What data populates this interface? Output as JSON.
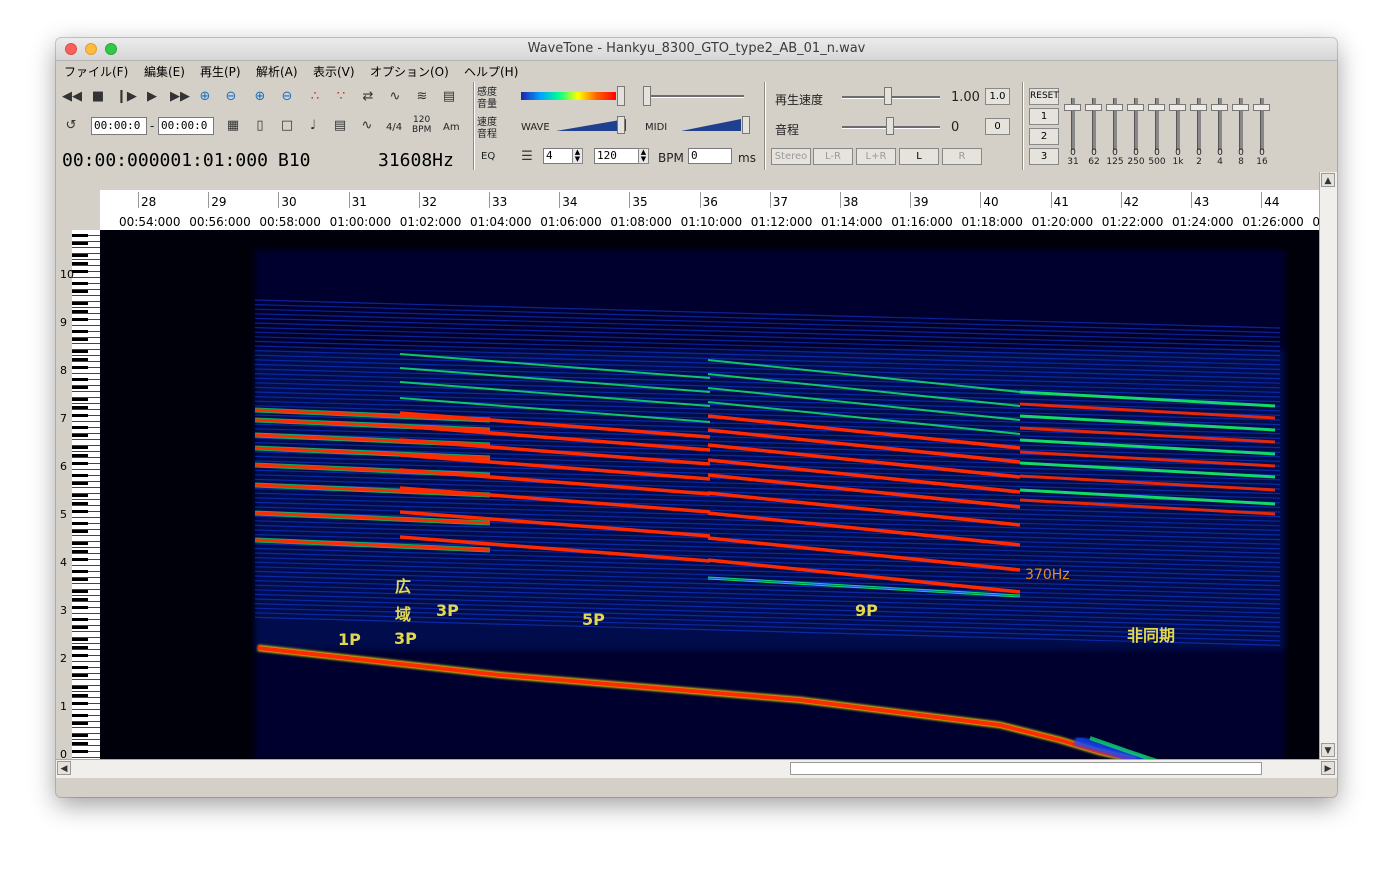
{
  "window": {
    "title": "WaveTone - Hankyu_8300_GTO_type2_AB_01_n.wav"
  },
  "menu": [
    {
      "label": "ファイル(F)",
      "name": "menu-file"
    },
    {
      "label": "編集(E)",
      "name": "menu-edit"
    },
    {
      "label": "再生(P)",
      "name": "menu-play"
    },
    {
      "label": "解析(A)",
      "name": "menu-analyze"
    },
    {
      "label": "表示(V)",
      "name": "menu-view"
    },
    {
      "label": "オプション(O)",
      "name": "menu-options"
    },
    {
      "label": "ヘルプ(H)",
      "name": "menu-help"
    }
  ],
  "transport": {
    "icons": [
      "rewind-icon",
      "stop-icon",
      "step-icon",
      "play-icon",
      "fast-forward-icon",
      "zoom-in-icon",
      "zoom-out-icon",
      "zoom-in-vertical-icon",
      "zoom-out-vertical-icon",
      "marker-icon",
      "marker-range-icon",
      "loop-arrows-icon",
      "waveform-icon",
      "waveform-alt-icon",
      "book-icon"
    ]
  },
  "toolbar2": {
    "start_time": "00:00:0",
    "dash": "-",
    "end_time": "00:00:0",
    "time_sig": "4/4",
    "bpm_top": "120",
    "bpm_bottom": "BPM",
    "chord_label": "Am"
  },
  "status": {
    "position": "00:00:000001:01:000",
    "note": "B10",
    "frequency": "31608Hz"
  },
  "labels": {
    "sensitivity": "感度",
    "volume": "音量",
    "speed": "速度",
    "pitch_short": "音程",
    "eq": "EQ",
    "wave": "WAVE",
    "midi": "MIDI",
    "bpm": "BPM",
    "ms": "ms",
    "beats_value": "4",
    "tempo_value": "120",
    "ms_value": "0"
  },
  "playback": {
    "speed_label": "再生速度",
    "speed_value": "1.00",
    "speed_reset": "1.0",
    "pitch_label": "音程",
    "pitch_value": "0",
    "pitch_reset": "0",
    "channels": [
      {
        "label": "Stereo",
        "enabled": false
      },
      {
        "label": "L-R",
        "enabled": false
      },
      {
        "label": "L+R",
        "enabled": false
      },
      {
        "label": "L",
        "enabled": true
      },
      {
        "label": "R",
        "enabled": false
      }
    ]
  },
  "eq": {
    "reset_label": "RESET",
    "presets": [
      "1",
      "2",
      "3"
    ],
    "bands": [
      {
        "freq": "31",
        "level": "0"
      },
      {
        "freq": "62",
        "level": "0"
      },
      {
        "freq": "125",
        "level": "0"
      },
      {
        "freq": "250",
        "level": "0"
      },
      {
        "freq": "500",
        "level": "0"
      },
      {
        "freq": "1k",
        "level": "0"
      },
      {
        "freq": "2",
        "level": "0"
      },
      {
        "freq": "4",
        "level": "0"
      },
      {
        "freq": "8",
        "level": "0"
      },
      {
        "freq": "16",
        "level": "0"
      }
    ]
  },
  "ruler": {
    "bars": [
      "28",
      "29",
      "30",
      "31",
      "32",
      "33",
      "34",
      "35",
      "36",
      "37",
      "38",
      "39",
      "40",
      "41",
      "42",
      "43",
      "44"
    ],
    "times": [
      "00:54:000",
      "00:56:000",
      "00:58:000",
      "01:00:000",
      "01:02:000",
      "01:04:000",
      "01:06:000",
      "01:08:000",
      "01:10:000",
      "01:12:000",
      "01:14:000",
      "01:16:000",
      "01:18:000",
      "01:20:000",
      "01:22:000",
      "01:24:000",
      "01:26:000",
      "0"
    ]
  },
  "octaves": [
    "10",
    "9",
    "8",
    "7",
    "6",
    "5",
    "4",
    "3",
    "2",
    "1",
    "0"
  ],
  "annotations": {
    "a1": "1P",
    "a2_1": "広",
    "a2_2": "域",
    "a2_3": "3P",
    "a3": "3P",
    "a4": "5P",
    "a5": "9P",
    "a6": "370Hz",
    "a7": "非同期"
  },
  "colors": {
    "spectrogram_bg": "#000000",
    "harmonic_hot": "#ff2a00",
    "harmonic_mid": "#14f068",
    "harmonic_cool": "#1446ff",
    "annotation_yellow": "#e3d74d",
    "annotation_orange": "#ea8a1a"
  }
}
